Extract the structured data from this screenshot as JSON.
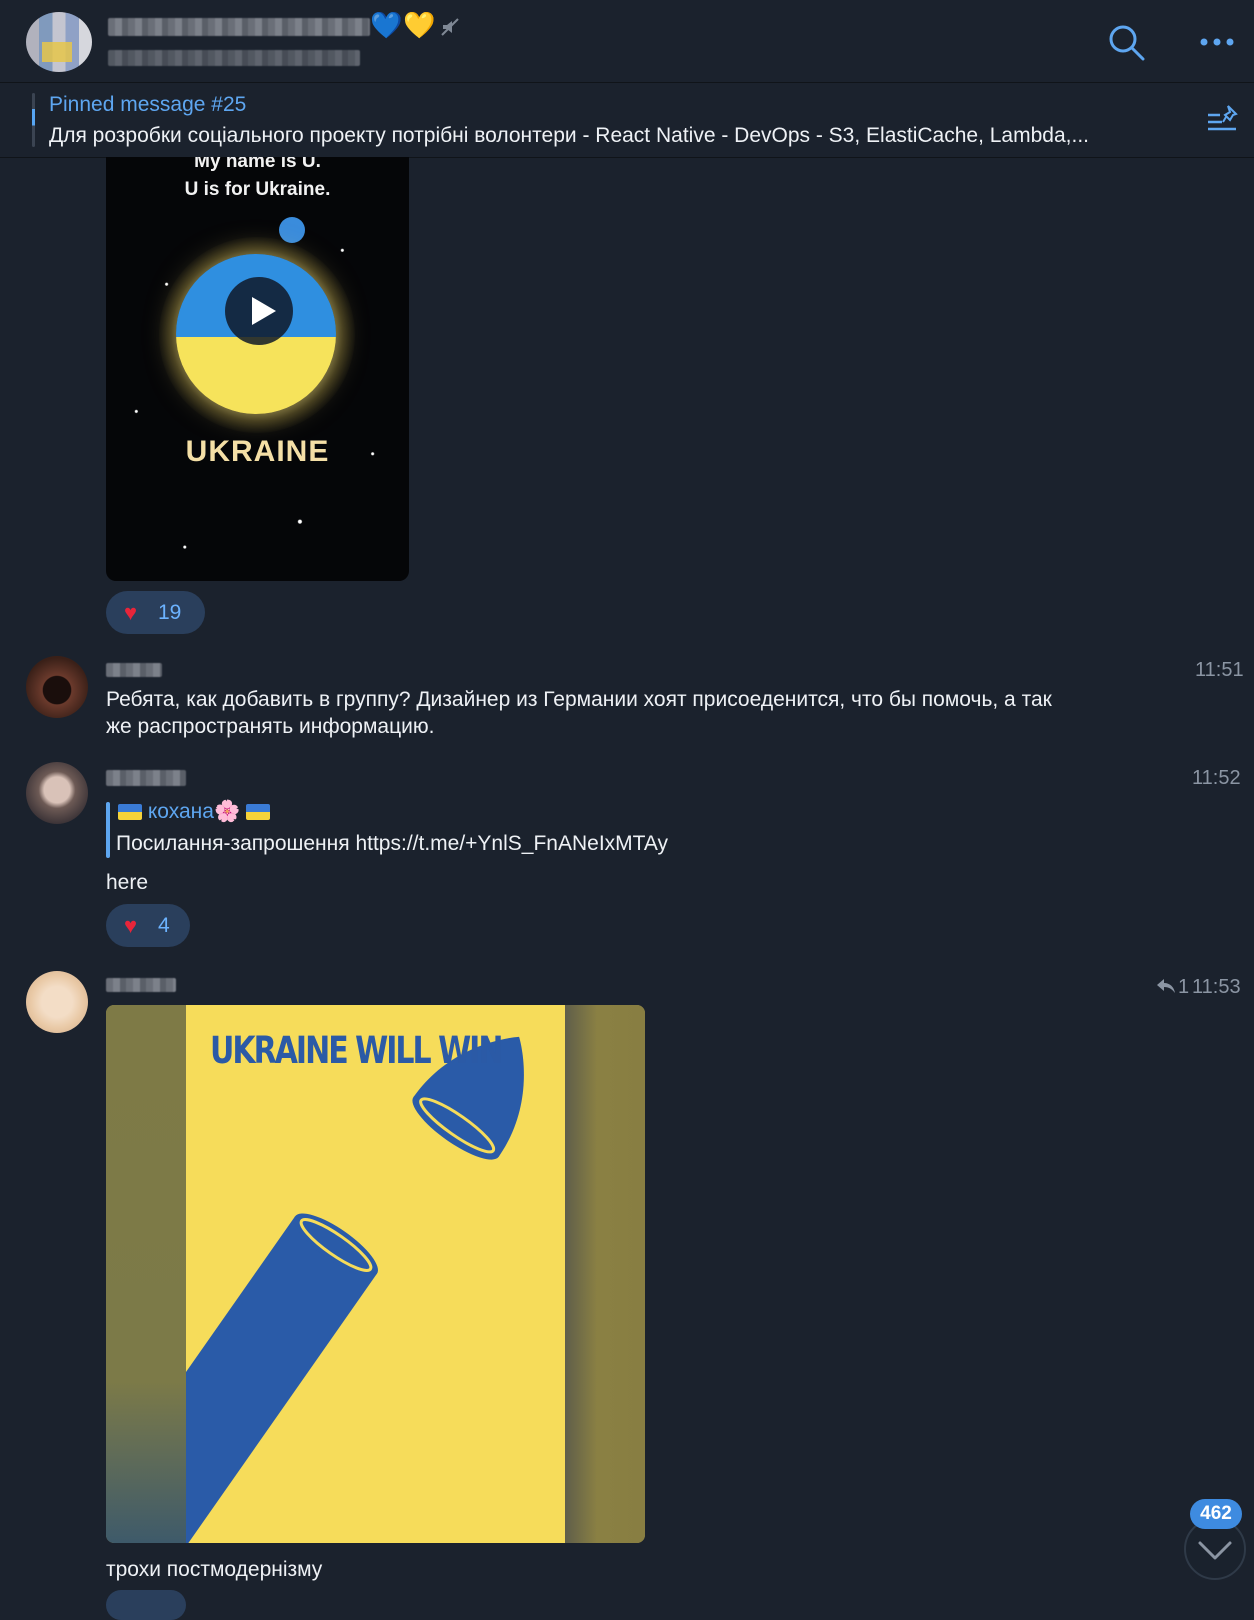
{
  "header": {
    "title_emojis": [
      "💙",
      "💛"
    ],
    "icons": {
      "mute": "muted-icon",
      "search": "search-icon",
      "more": "more-dots-icon"
    }
  },
  "pinned": {
    "title": "Pinned message #25",
    "text": "Для розробки соціального проекту потрібні волонтери  - React Native - DevOps - S3, ElastiCache, Lambda,..."
  },
  "video_message": {
    "caption_line1": "My name is U.",
    "caption_line2": "U is for Ukraine.",
    "title": "UKRAINE",
    "reaction": {
      "emoji": "♥",
      "count": "19"
    }
  },
  "messages": [
    {
      "time": "11:51",
      "text_line1": "Ребята, как добавить в группу? Дизайнер из Германии хоят присоеденится, что бы помочь, а так",
      "text_line2": "же распространять информацию."
    },
    {
      "time": "11:52",
      "reply": {
        "name": "кохана",
        "name_emoji": "🌸",
        "text": "Посилання-запрошення https://t.me/+YnlS_FnANeIxMTAy"
      },
      "text": "here",
      "reaction": {
        "emoji": "♥",
        "count": "4"
      }
    },
    {
      "reply_count": "1",
      "time": "11:53",
      "poster_title": "UKRAINE WILL WIN",
      "text": "трохи постмодернізму"
    }
  ],
  "unread_count": "462",
  "colors": {
    "accent": "#5ea6f0",
    "background": "#1b222d",
    "reaction_bg": "#2a3f5c",
    "heart": "#e8253a"
  }
}
